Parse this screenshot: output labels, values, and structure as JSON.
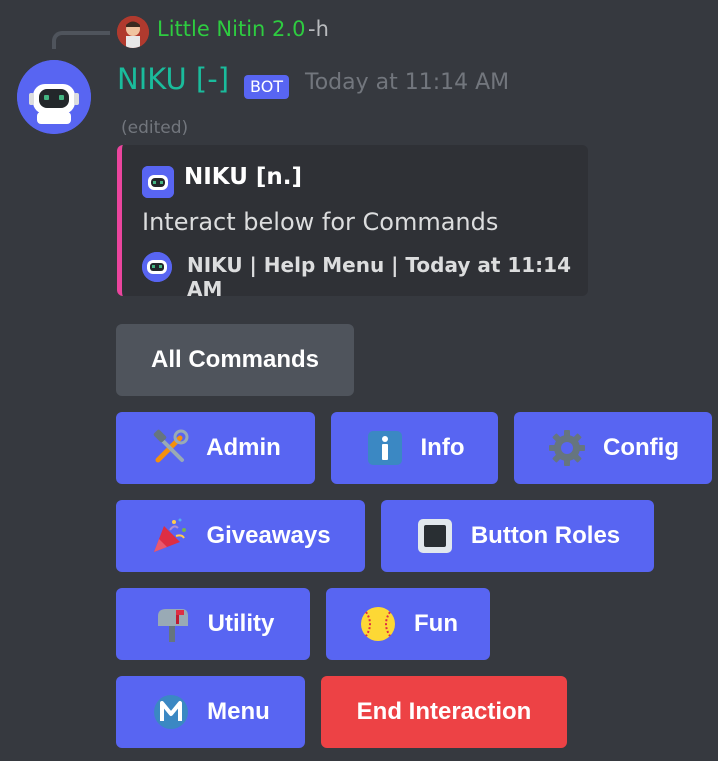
{
  "reply": {
    "author": "Little Nitin 2.0",
    "text": "-h"
  },
  "message": {
    "username": "NIKU [-]",
    "bot_tag": "BOT",
    "timestamp": "Today at 11:14 AM",
    "edited": "(edited)"
  },
  "embed": {
    "author": "NIKU [n.]",
    "description": "Interact below for Commands",
    "footer": "NIKU | Help Menu | Today at 11:14 AM",
    "accent_color": "#eb459e"
  },
  "buttons": {
    "all_commands": "All Commands",
    "admin": "Admin",
    "info": "Info",
    "config": "Config",
    "giveaways": "Giveaways",
    "button_roles": "Button Roles",
    "utility": "Utility",
    "fun": "Fun",
    "menu": "Menu",
    "end_interaction": "End Interaction"
  },
  "icons": {
    "admin": "hammer-and-wrench-icon",
    "info": "information-icon",
    "config": "gear-icon",
    "giveaways": "party-popper-icon",
    "button_roles": "black-square-button-icon",
    "utility": "mailbox-icon",
    "fun": "softball-icon",
    "menu": "circled-m-icon"
  },
  "colors": {
    "background": "#36393f",
    "blurple": "#5865f2",
    "secondary": "#4f545c",
    "danger": "#ed4245",
    "reply_name": "#2ecc40",
    "username": "#1abc9c"
  }
}
